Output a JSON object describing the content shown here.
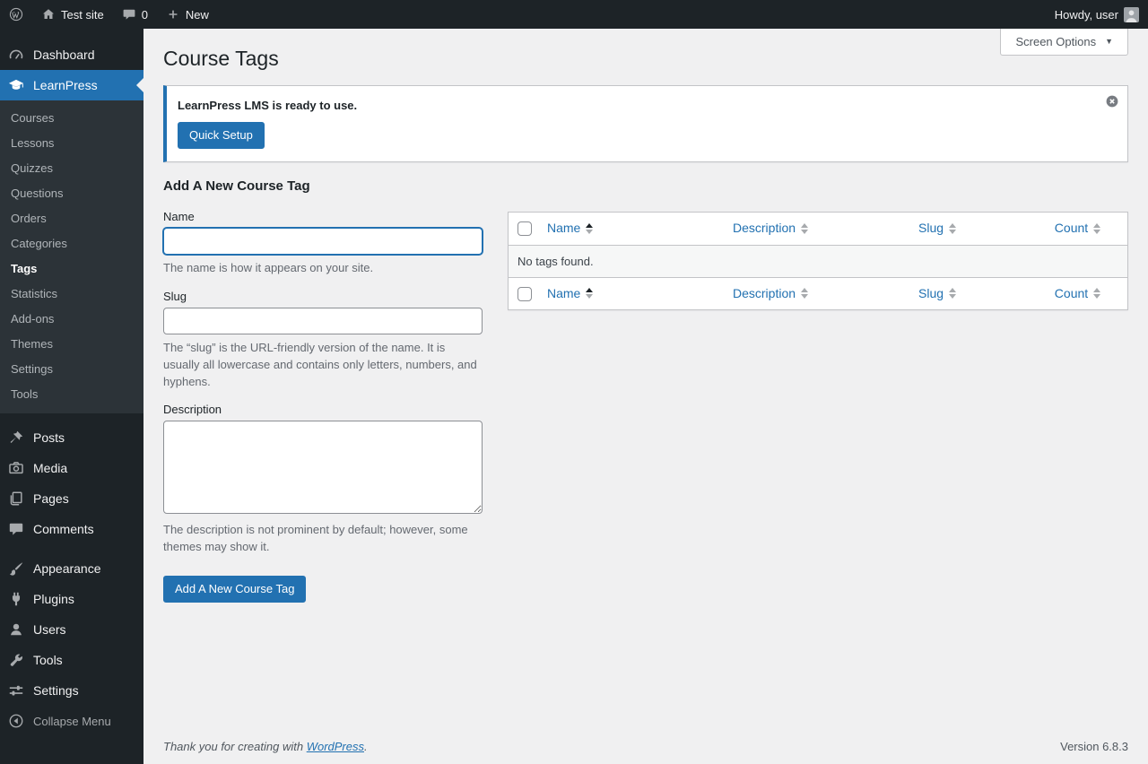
{
  "theme": {
    "accent": "#2271b1",
    "admin_bar_bg": "#1d2327",
    "sidebar_bg": "#1d2327",
    "submenu_bg": "#2c3338",
    "content_bg": "#f0f0f1"
  },
  "admin_bar": {
    "site_name": "Test site",
    "comment_count": "0",
    "new_label": "New",
    "howdy": "Howdy, user"
  },
  "sidebar": {
    "dashboard": "Dashboard",
    "learnpress": "LearnPress",
    "learnpress_submenu": [
      "Courses",
      "Lessons",
      "Quizzes",
      "Questions",
      "Orders",
      "Categories",
      "Tags",
      "Statistics",
      "Add-ons",
      "Themes",
      "Settings",
      "Tools"
    ],
    "current_submenu_item": "Tags",
    "posts": "Posts",
    "media": "Media",
    "pages": "Pages",
    "comments": "Comments",
    "appearance": "Appearance",
    "plugins": "Plugins",
    "users": "Users",
    "tools": "Tools",
    "settings": "Settings",
    "collapse_label": "Collapse Menu"
  },
  "page": {
    "title": "Course Tags",
    "screen_options_label": "Screen Options",
    "notice": {
      "message": "LearnPress LMS is ready to use.",
      "quick_setup_label": "Quick Setup"
    },
    "form": {
      "heading": "Add A New Course Tag",
      "name_label": "Name",
      "name_value": "",
      "name_help": "The name is how it appears on your site.",
      "slug_label": "Slug",
      "slug_value": "",
      "slug_help": "The “slug” is the URL-friendly version of the name. It is usually all lowercase and contains only letters, numbers, and hyphens.",
      "description_label": "Description",
      "description_value": "",
      "description_help": "The description is not prominent by default; however, some themes may show it.",
      "submit_label": "Add A New Course Tag"
    },
    "table": {
      "columns": [
        "Name",
        "Description",
        "Slug",
        "Count"
      ],
      "sorted_column": "Name",
      "sort_order": "asc",
      "empty_text": "No tags found."
    }
  },
  "footer": {
    "thanks_prefix": "Thank you for creating with ",
    "wordpress_link": "WordPress",
    "suffix": ".",
    "version": "Version 6.8.3"
  }
}
